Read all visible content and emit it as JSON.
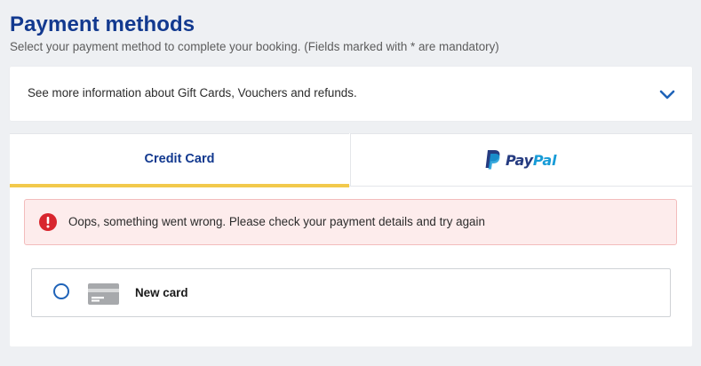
{
  "header": {
    "title": "Payment methods",
    "subtitle": "Select your payment method to complete your booking.   (Fields marked with * are mandatory)"
  },
  "info": {
    "text": "See more information about Gift Cards, Vouchers and refunds.",
    "icon": "chevron-down-icon"
  },
  "tabs": [
    {
      "label": "Credit Card",
      "selected": true
    },
    {
      "label": "PayPal",
      "logo_parts": [
        "Pay",
        "Pal"
      ],
      "selected": false
    }
  ],
  "alert": {
    "text": "Oops, something went wrong. Please check your payment details and try again",
    "icon": "error-icon",
    "color": "#d8262e"
  },
  "card_option": {
    "label": "New card",
    "selected": false,
    "icon": "credit-card-icon"
  },
  "colors": {
    "brand": "#12398f",
    "tab_indicator": "#f2c94c",
    "radio": "#1f63b8",
    "paypal_dark": "#253b80",
    "paypal_light": "#179bd7"
  }
}
